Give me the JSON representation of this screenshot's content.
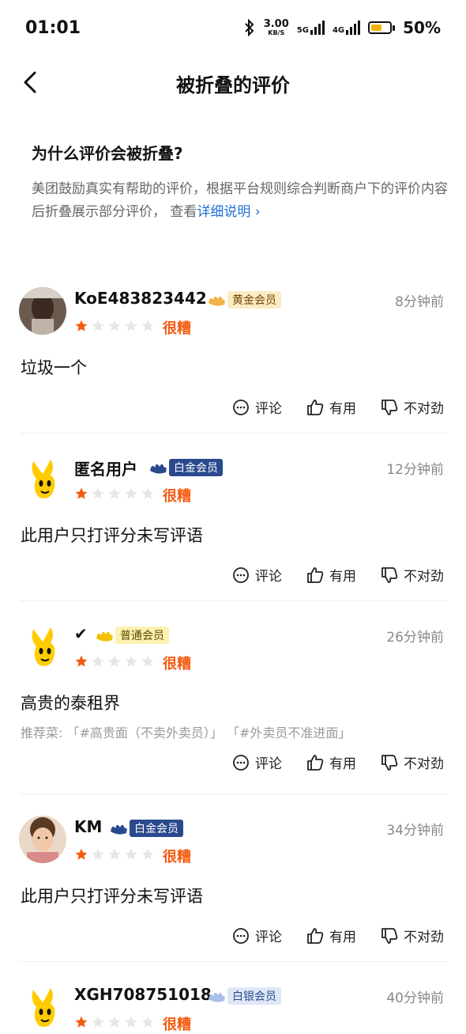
{
  "status": {
    "time": "01:01",
    "net_speed_value": "3.00",
    "net_speed_unit": "KB/S",
    "sig1": "5G",
    "sig2": "4G",
    "battery": "50%"
  },
  "header": {
    "title": "被折叠的评价"
  },
  "explain": {
    "title": "为什么评价会被折叠?",
    "body": "美团鼓励真实有帮助的评价，根据平台规则综合判断商户下的评价内容后折叠展示部分评价， 查看",
    "link": "详细说明"
  },
  "actions": {
    "comment": "评论",
    "useful": "有用",
    "wrong": "不对劲"
  },
  "rating_label": "很糟",
  "reviews": [
    {
      "user": "KoE483823442",
      "badge": "黄金会员",
      "time": "8分钟前",
      "stars": 1,
      "text": "垃圾一个"
    },
    {
      "user": "匿名用户",
      "badge": "白金会员",
      "time": "12分钟前",
      "stars": 1,
      "text": "此用户只打评分未写评语"
    },
    {
      "user": "✔",
      "badge": "普通会员",
      "time": "26分钟前",
      "stars": 1,
      "text": "高贵的泰租界",
      "recommend": "推荐菜: 「#高贵面（不卖外卖员）」 「#外卖员不准进面」"
    },
    {
      "user": "KM",
      "badge": "白金会员",
      "time": "34分钟前",
      "stars": 1,
      "text": "此用户只打评分未写评语"
    },
    {
      "user": "XGH708751018",
      "badge": "白银会员",
      "time": "40分钟前",
      "stars": 1
    }
  ],
  "colors": {
    "accent": "#f35b10",
    "link": "#1f6fd1"
  }
}
